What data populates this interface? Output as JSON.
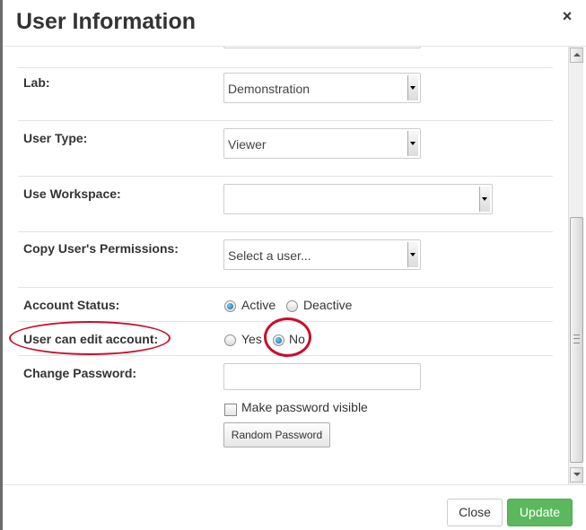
{
  "dialog": {
    "title": "User Information",
    "close_glyph": "×"
  },
  "form": {
    "lab": {
      "label": "Lab:",
      "value": "Demonstration"
    },
    "user_type": {
      "label": "User Type:",
      "value": "Viewer"
    },
    "use_workspace": {
      "label": "Use Workspace:",
      "value": ""
    },
    "copy_permissions": {
      "label": "Copy User's Permissions:",
      "value": "Select a user..."
    },
    "account_status": {
      "label": "Account Status:",
      "options": [
        "Active",
        "Deactive"
      ],
      "selected": "Active"
    },
    "edit_account": {
      "label": "User can edit account:",
      "options": [
        "Yes",
        "No"
      ],
      "selected": "No"
    },
    "change_password": {
      "label": "Change Password:",
      "value": "",
      "make_visible_label": "Make password visible",
      "make_visible_checked": false,
      "random_button": "Random Password"
    }
  },
  "footer": {
    "close_label": "Close",
    "update_label": "Update"
  },
  "colors": {
    "update_button": "#5cb85c",
    "annotation": "#c8102e"
  }
}
